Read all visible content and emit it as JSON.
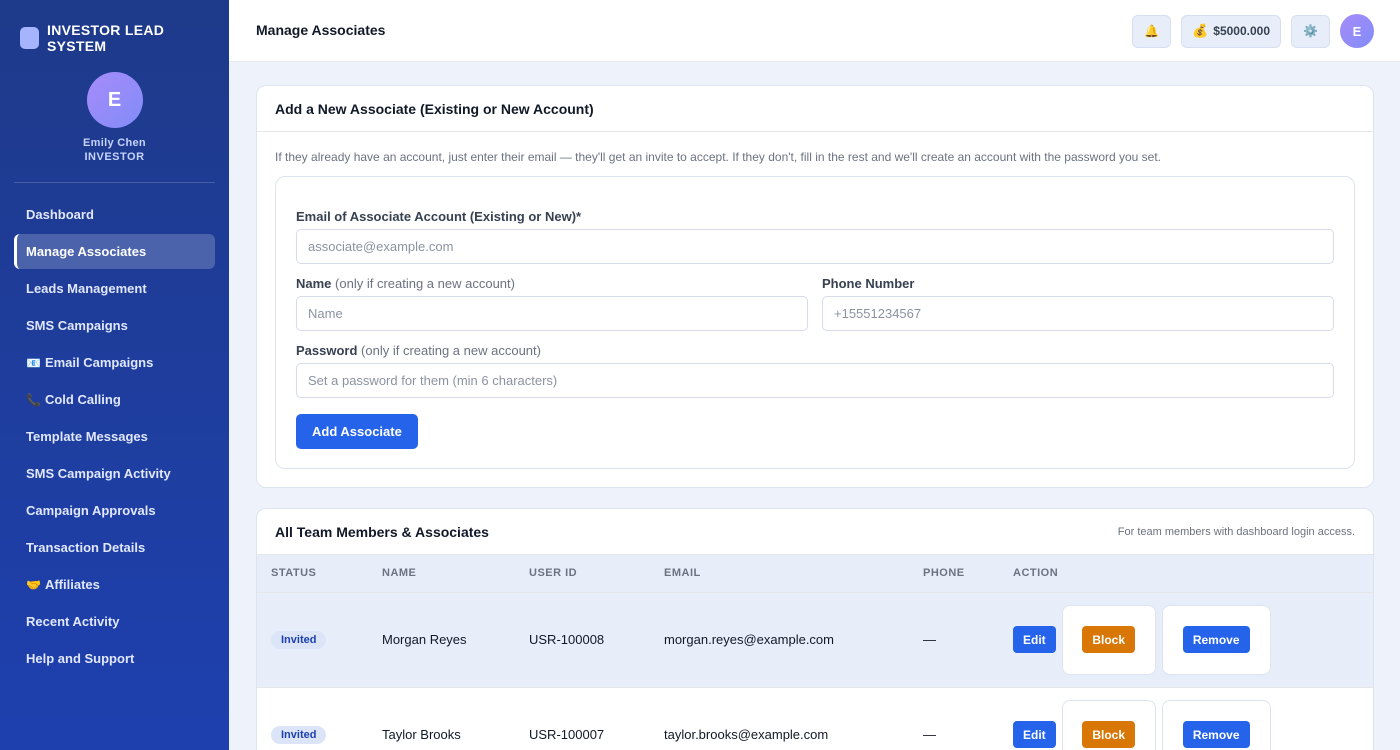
{
  "brand": {
    "name": "INVESTOR LEAD SYSTEM"
  },
  "profile": {
    "initial": "E",
    "name": "Emily Chen",
    "role": "INVESTOR"
  },
  "nav": {
    "items": [
      {
        "label": "Dashboard",
        "icon": ""
      },
      {
        "label": "Manage Associates",
        "icon": "",
        "active": true
      },
      {
        "label": "Leads Management",
        "icon": ""
      },
      {
        "label": "SMS Campaigns",
        "icon": ""
      },
      {
        "label": "Email Campaigns",
        "icon": "📧"
      },
      {
        "label": "Cold Calling",
        "icon": "📞"
      },
      {
        "label": "Template Messages",
        "icon": ""
      },
      {
        "label": "SMS Campaign Activity",
        "icon": ""
      },
      {
        "label": "Campaign Approvals",
        "icon": ""
      },
      {
        "label": "Transaction Details",
        "icon": ""
      },
      {
        "label": "Affiliates",
        "icon": "🤝"
      },
      {
        "label": "Recent Activity",
        "icon": ""
      },
      {
        "label": "Help and Support",
        "icon": ""
      }
    ]
  },
  "topbar": {
    "title": "Manage Associates",
    "bell_icon": "🔔",
    "coin_icon": "💰",
    "balance": "$5000.000",
    "gear_icon": "⚙️",
    "avatar_initial": "E"
  },
  "add_form": {
    "title": "Add a New Associate (Existing or New Account)",
    "description": "If they already have an account, just enter their email — they'll get an invite to accept. If they don't, fill in the rest and we'll create an account with the password you set.",
    "email_label": "Email of Associate Account (Existing or New)*",
    "email_placeholder": "associate@example.com",
    "name_label": "Name",
    "name_hint": "(only if creating a new account)",
    "name_placeholder": "Name",
    "phone_label": "Phone Number",
    "phone_placeholder": "+15551234567",
    "password_label": "Password",
    "password_hint": "(only if creating a new account)",
    "password_placeholder": "Set a password for them (min 6 characters)",
    "submit_label": "Add Associate"
  },
  "team": {
    "title": "All Team Members & Associates",
    "note": "For team members with dashboard login access.",
    "columns": [
      "STATUS",
      "NAME",
      "USER ID",
      "EMAIL",
      "PHONE",
      "ACTION"
    ],
    "rows": [
      {
        "status": "Invited",
        "name": "Morgan Reyes",
        "user_id": "USR-100008",
        "email": "morgan.reyes@example.com",
        "phone": "—"
      },
      {
        "status": "Invited",
        "name": "Taylor Brooks",
        "user_id": "USR-100007",
        "email": "taylor.brooks@example.com",
        "phone": "—"
      }
    ],
    "edit_label": "Edit",
    "block_label": "Block",
    "remove_label": "Remove"
  }
}
